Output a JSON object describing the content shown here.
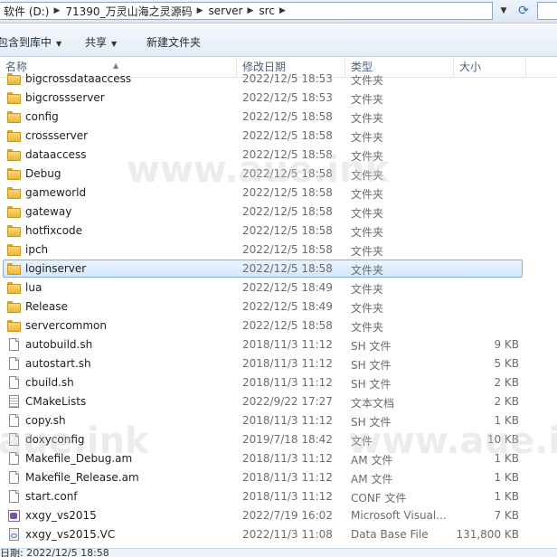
{
  "address": {
    "crumbs": [
      "软件 (D:)",
      "71390_万灵山海之灵源码",
      "server",
      "src"
    ]
  },
  "toolbar": {
    "include_label": "包含到库中",
    "share_label": "共享",
    "new_folder_label": "新建文件夹"
  },
  "columns": {
    "name": "名称",
    "date": "修改日期",
    "type": "类型",
    "size": "大小"
  },
  "files": [
    {
      "name": "bigcrossdataaccess",
      "date": "2022/12/5 18:53",
      "type": "文件夹",
      "size": "",
      "icon": "folder"
    },
    {
      "name": "bigcrossserver",
      "date": "2022/12/5 18:53",
      "type": "文件夹",
      "size": "",
      "icon": "folder"
    },
    {
      "name": "config",
      "date": "2022/12/5 18:58",
      "type": "文件夹",
      "size": "",
      "icon": "folder"
    },
    {
      "name": "crossserver",
      "date": "2022/12/5 18:58",
      "type": "文件夹",
      "size": "",
      "icon": "folder"
    },
    {
      "name": "dataaccess",
      "date": "2022/12/5 18:58",
      "type": "文件夹",
      "size": "",
      "icon": "folder"
    },
    {
      "name": "Debug",
      "date": "2022/12/5 18:58",
      "type": "文件夹",
      "size": "",
      "icon": "folder"
    },
    {
      "name": "gameworld",
      "date": "2022/12/5 18:58",
      "type": "文件夹",
      "size": "",
      "icon": "folder"
    },
    {
      "name": "gateway",
      "date": "2022/12/5 18:58",
      "type": "文件夹",
      "size": "",
      "icon": "folder"
    },
    {
      "name": "hotfixcode",
      "date": "2022/12/5 18:58",
      "type": "文件夹",
      "size": "",
      "icon": "folder"
    },
    {
      "name": "ipch",
      "date": "2022/12/5 18:58",
      "type": "文件夹",
      "size": "",
      "icon": "folder"
    },
    {
      "name": "loginserver",
      "date": "2022/12/5 18:58",
      "type": "文件夹",
      "size": "",
      "icon": "folder",
      "selected": true
    },
    {
      "name": "lua",
      "date": "2022/12/5 18:49",
      "type": "文件夹",
      "size": "",
      "icon": "folder"
    },
    {
      "name": "Release",
      "date": "2022/12/5 18:49",
      "type": "文件夹",
      "size": "",
      "icon": "folder"
    },
    {
      "name": "servercommon",
      "date": "2022/12/5 18:58",
      "type": "文件夹",
      "size": "",
      "icon": "folder"
    },
    {
      "name": "autobuild.sh",
      "date": "2018/11/3 11:12",
      "type": "SH 文件",
      "size": "9 KB",
      "icon": "file"
    },
    {
      "name": "autostart.sh",
      "date": "2018/11/3 11:12",
      "type": "SH 文件",
      "size": "5 KB",
      "icon": "file"
    },
    {
      "name": "cbuild.sh",
      "date": "2018/11/3 11:12",
      "type": "SH 文件",
      "size": "2 KB",
      "icon": "file"
    },
    {
      "name": "CMakeLists",
      "date": "2022/9/22 17:27",
      "type": "文本文档",
      "size": "2 KB",
      "icon": "textfile"
    },
    {
      "name": "copy.sh",
      "date": "2018/11/3 11:12",
      "type": "SH 文件",
      "size": "1 KB",
      "icon": "file"
    },
    {
      "name": "doxyconfig",
      "date": "2019/7/18 18:42",
      "type": "文件",
      "size": "10 KB",
      "icon": "file"
    },
    {
      "name": "Makefile_Debug.am",
      "date": "2018/11/3 11:12",
      "type": "AM 文件",
      "size": "1 KB",
      "icon": "file"
    },
    {
      "name": "Makefile_Release.am",
      "date": "2018/11/3 11:12",
      "type": "AM 文件",
      "size": "1 KB",
      "icon": "file"
    },
    {
      "name": "start.conf",
      "date": "2018/11/3 11:12",
      "type": "CONF 文件",
      "size": "1 KB",
      "icon": "file"
    },
    {
      "name": "xxgy_vs2015",
      "date": "2022/7/19 16:02",
      "type": "Microsoft Visual...",
      "size": "7 KB",
      "icon": "sln"
    },
    {
      "name": "xxgy_vs2015.VC",
      "date": "2022/11/3 11:08",
      "type": "Data Base File",
      "size": "131,800 KB",
      "icon": "vc"
    }
  ],
  "watermarks": [
    "www.aue.ink",
    "www.aue.ink",
    "aue.ink",
    "www.aue.i"
  ],
  "statusbar": {
    "text": "日期: 2022/12/5 18:58"
  },
  "colors": {
    "selection_fill": "#d4e7fb",
    "selection_border": "#84acdd",
    "folder_yellow": "#f9d774"
  }
}
